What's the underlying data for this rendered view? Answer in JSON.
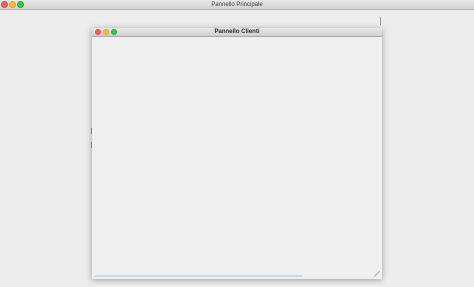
{
  "main_window": {
    "title": "Pannello Principale"
  },
  "child_window": {
    "title": "Pannello Clienti"
  },
  "colors": {
    "desktop_bg": "#ececec",
    "close": "#fc605c",
    "minimize": "#fdbc40",
    "zoom": "#34c84a"
  }
}
